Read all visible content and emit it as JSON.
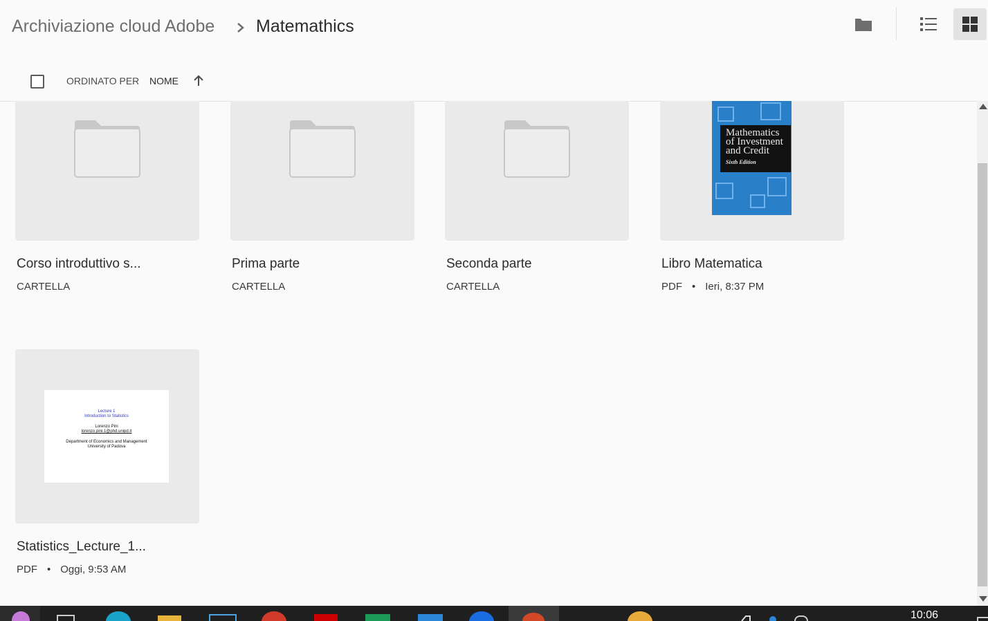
{
  "breadcrumb": {
    "root": "Archiviazione cloud Adobe",
    "current": "Matemathics"
  },
  "toolbar": {
    "new_folder_icon": "folder-icon",
    "list_view_icon": "list-view-icon",
    "grid_view_icon": "grid-view-icon",
    "active_view": "grid"
  },
  "sort": {
    "label": "ORDINATO PER",
    "key": "NOME",
    "direction": "ascending"
  },
  "items": [
    {
      "title": "Corso introduttivo s...",
      "kind": "CARTELLA",
      "date": ""
    },
    {
      "title": "Prima parte",
      "kind": "CARTELLA",
      "date": ""
    },
    {
      "title": "Seconda parte",
      "kind": "CARTELLA",
      "date": ""
    },
    {
      "title": "Libro Matematica",
      "kind": "PDF",
      "date": "Ieri, 8:37 PM",
      "cover": {
        "line1": "Mathematics",
        "line2": "of Investment",
        "line3": "and Credit",
        "edition": "Sixth Edition"
      }
    },
    {
      "title": "Statistics_Lecture_1...",
      "kind": "PDF",
      "date": "Oggi, 9:53 AM",
      "slide": {
        "line1": "Lecture 1",
        "line2": "Introduction to Statistics",
        "author": "Lorenzo Pini",
        "email": "lorenzo.pini.1@phd.unipd.it",
        "dept": "Department of Economics and Management",
        "univ": "University of Padova"
      }
    }
  ],
  "taskbar": {
    "clock": "10:06"
  },
  "colors": {
    "background": "#fafafa",
    "thumb": "#eaeaea",
    "book_cover": "#2a7fc9",
    "slide_title": "#2a35c0"
  }
}
